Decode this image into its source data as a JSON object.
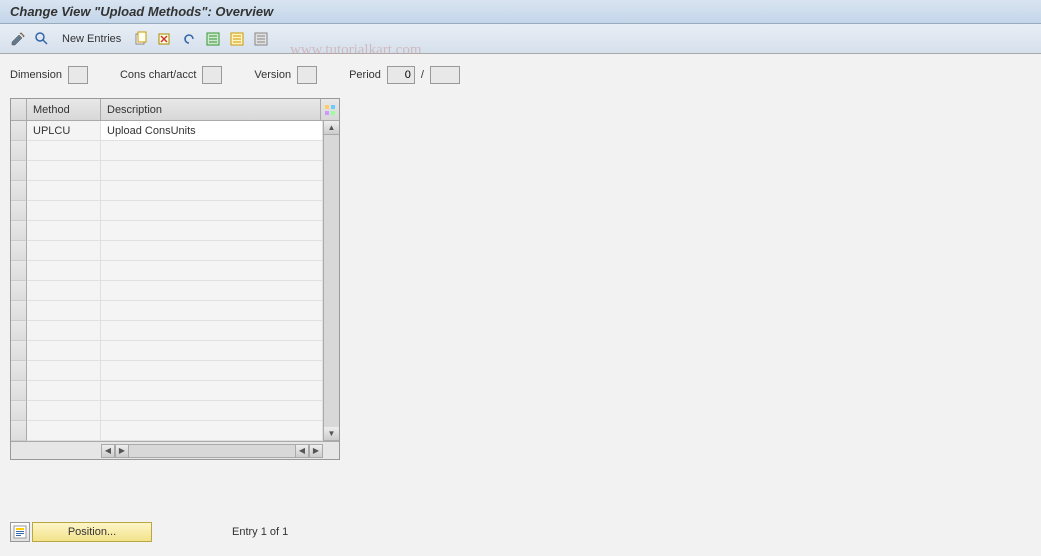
{
  "header": {
    "title": "Change View \"Upload Methods\": Overview"
  },
  "toolbar": {
    "new_entries_label": "New Entries"
  },
  "watermark": "www.tutorialkart.com",
  "filters": {
    "dimension_label": "Dimension",
    "dimension_value": "",
    "cca_label": "Cons chart/acct",
    "cca_value": "",
    "version_label": "Version",
    "version_value": "",
    "period_label": "Period",
    "period_value": "0",
    "period_sep": "/",
    "period_year": ""
  },
  "table": {
    "columns": {
      "method": "Method",
      "description": "Description"
    },
    "rows": [
      {
        "method": "UPLCU",
        "description": "Upload ConsUnits"
      }
    ],
    "empty_rows": 15
  },
  "footer": {
    "position_label": "Position...",
    "entry_text": "Entry 1 of 1"
  }
}
